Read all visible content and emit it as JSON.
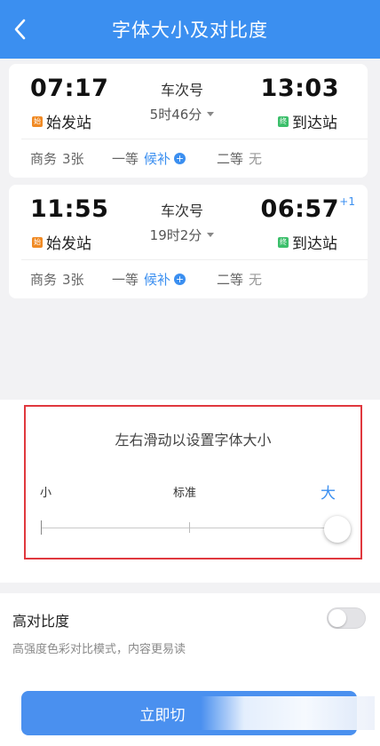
{
  "header": {
    "title": "字体大小及对比度"
  },
  "trains": [
    {
      "depart_time": "07:17",
      "depart_station": "始发站",
      "depart_tag": "始",
      "train_no": "车次号",
      "duration": "5时46分",
      "arrive_time": "13:03",
      "arrive_station": "到达站",
      "arrive_tag": "终",
      "day_offset": "",
      "seats": [
        {
          "name": "商务",
          "value": "3张"
        },
        {
          "name": "一等",
          "value": "候补"
        },
        {
          "name": "二等",
          "value": "无"
        }
      ]
    },
    {
      "depart_time": "11:55",
      "depart_station": "始发站",
      "depart_tag": "始",
      "train_no": "车次号",
      "duration": "19时2分",
      "arrive_time": "06:57",
      "arrive_station": "到达站",
      "arrive_tag": "终",
      "day_offset": "+1",
      "seats": [
        {
          "name": "商务",
          "value": "3张"
        },
        {
          "name": "一等",
          "value": "候补"
        },
        {
          "name": "二等",
          "value": "无"
        }
      ]
    }
  ],
  "font_size": {
    "title": "左右滑动以设置字体大小",
    "label_small": "小",
    "label_standard": "标准",
    "label_large": "大",
    "slider_level": 1.0
  },
  "contrast": {
    "title": "高对比度",
    "description": "高强度色彩对比模式，内容更易读",
    "enabled": false
  },
  "action": {
    "button_label": "立即切"
  },
  "colors": {
    "accent": "#3b8ff0",
    "highlight_box": "#e0383e"
  }
}
